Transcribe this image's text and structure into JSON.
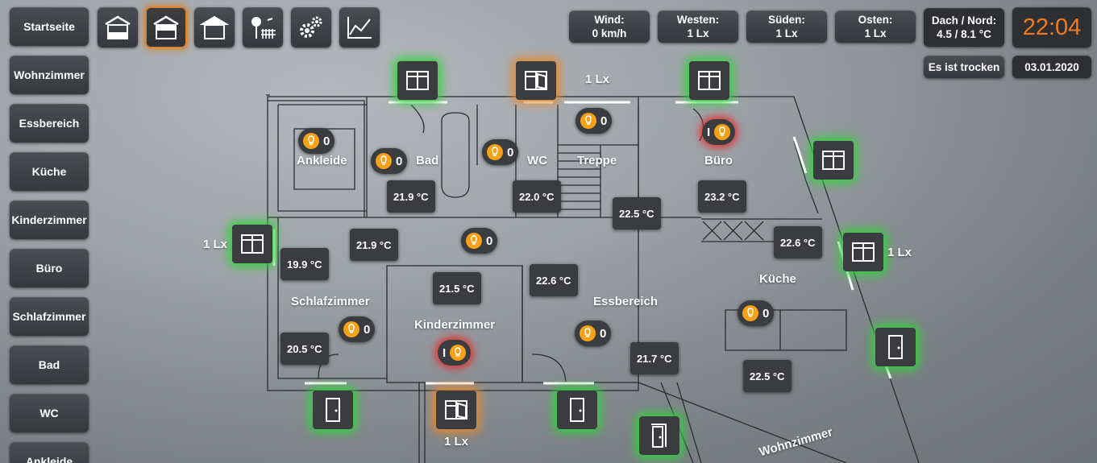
{
  "sidebar": {
    "items": [
      {
        "label": "Startseite"
      },
      {
        "label": "Wohnzimmer"
      },
      {
        "label": "Essbereich"
      },
      {
        "label": "Küche"
      },
      {
        "label": "Kinderzimmer"
      },
      {
        "label": "Büro"
      },
      {
        "label": "Schlafzimmer"
      },
      {
        "label": "Bad"
      },
      {
        "label": "WC"
      },
      {
        "label": "Ankleide"
      }
    ]
  },
  "toolbar": {
    "icons": [
      "house-ground-floor-icon",
      "house-upper-floor-icon",
      "house-roof-icon",
      "garden-icon",
      "gears-icon",
      "chart-icon"
    ],
    "active_index": 1
  },
  "weather": {
    "wind": {
      "label": "Wind:",
      "value": "0 km/h"
    },
    "west": {
      "label": "Westen:",
      "value": "1 Lx"
    },
    "south": {
      "label": "Süden:",
      "value": "1 Lx"
    },
    "east": {
      "label": "Osten:",
      "value": "1 Lx"
    },
    "roof": {
      "label": "Dach / Nord:",
      "value": "4.5 / 8.1 °C"
    },
    "time": "22:04",
    "rain": "Es ist trocken",
    "date": "03.01.2020"
  },
  "rooms": {
    "ankleide": "Ankleide",
    "bad": "Bad",
    "wc": "WC",
    "treppe": "Treppe",
    "buero": "Büro",
    "kueche": "Küche",
    "schlafzimmer": "Schlafzimmer",
    "kinderzimmer": "Kinderzimmer",
    "essbereich": "Essbereich",
    "wohnzimmer": "Wohnzimmer"
  },
  "temperatures": {
    "bad": "21.9 °C",
    "wc": "22.0 °C",
    "treppe": "22.5 °C",
    "buero": "23.2 °C",
    "flur": "21.9 °C",
    "schlafzimmer_top": "19.9 °C",
    "kueche": "22.6 °C",
    "kinderzimmer": "21.5 °C",
    "essbereich_top": "22.6 °C",
    "schlafzimmer_bottom": "20.5 °C",
    "essbereich_bottom": "21.7 °C",
    "kueche_bottom": "22.5 °C"
  },
  "lamps": {
    "ankleide": "0",
    "bad": "0",
    "wc": "0",
    "treppe": "0",
    "buero": "I",
    "flur": "0",
    "kueche": "0",
    "schlafzimmer": "0",
    "essbereich": "0",
    "kinderzimmer": "I"
  },
  "lux": {
    "top": "1 Lx",
    "left": "1 Lx",
    "right": "1 Lx",
    "bottom": "1 Lx"
  },
  "colors": {
    "accent": "#e07b1a",
    "window_closed": "#2fd33a",
    "window_tilted": "#e8892a",
    "lamp_on": "#e02d2d",
    "bulb": "#f5a218"
  }
}
